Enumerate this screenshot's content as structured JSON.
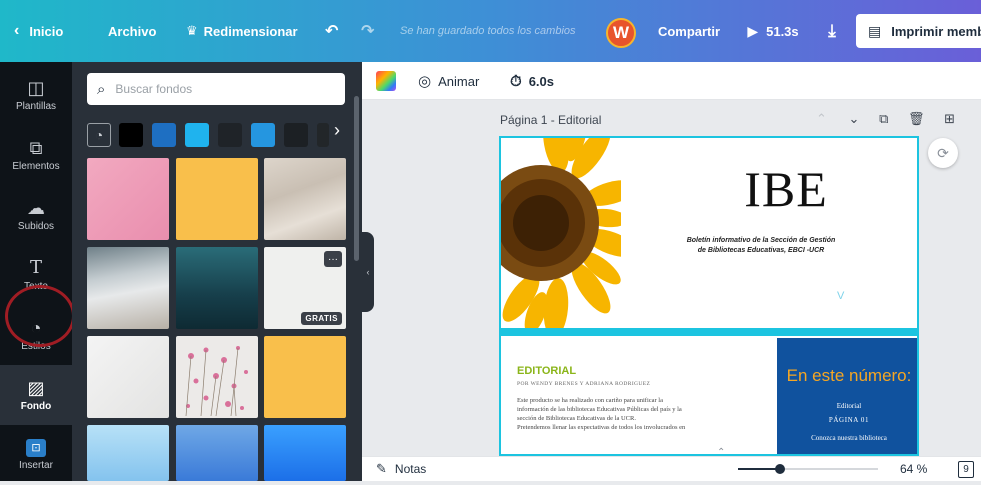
{
  "topbar": {
    "back_label": "Inicio",
    "file_label": "Archivo",
    "resize_label": "Redimensionar",
    "saved_status": "Se han guardado todos los cambios",
    "avatar_initial": "W",
    "share_label": "Compartir",
    "play_duration": "51.3s",
    "print_label": "Imprimir membr"
  },
  "rail": {
    "items": [
      {
        "label": "Plantillas",
        "icon": "template-icon"
      },
      {
        "label": "Elementos",
        "icon": "elements-icon"
      },
      {
        "label": "Subidos",
        "icon": "upload-icon"
      },
      {
        "label": "Texto",
        "icon": "text-icon"
      },
      {
        "label": "Estilos",
        "icon": "palette-icon"
      },
      {
        "label": "Fondo",
        "icon": "background-icon"
      },
      {
        "label": "Insertar",
        "icon": "embed-icon"
      }
    ]
  },
  "panel": {
    "search_placeholder": "Buscar fondos",
    "swatch_colors": [
      "#000000",
      "#1e6fc2",
      "#1fb3ee",
      "#1f2328",
      "#2596e0",
      "#1c2024",
      "#222629"
    ],
    "tiles": [
      {
        "name": "pink-texture",
        "badge": ""
      },
      {
        "name": "yellow-plain",
        "badge": ""
      },
      {
        "name": "sand-texture",
        "badge": ""
      },
      {
        "name": "beach-waves",
        "badge": ""
      },
      {
        "name": "teal-gradient",
        "badge": ""
      },
      {
        "name": "white-paper",
        "badge": "GRATIS"
      },
      {
        "name": "white-wall",
        "badge": ""
      },
      {
        "name": "pink-flowers",
        "badge": ""
      },
      {
        "name": "yellow-plain-2",
        "badge": ""
      },
      {
        "name": "light-blue-gradient",
        "badge": ""
      },
      {
        "name": "blue-gradient",
        "badge": ""
      },
      {
        "name": "blue-bright",
        "badge": ""
      }
    ]
  },
  "editor": {
    "animate_label": "Animar",
    "duration": "6.0s",
    "page_label": "Página 1 - Editorial",
    "notes_label": "Notas",
    "zoom_percent": "64 %",
    "page_count": "9",
    "zoom_level": 0.3
  },
  "document": {
    "title": "IBE",
    "subtitle_line1": "Boletín informativo de la Sección de Gestión",
    "subtitle_line2": "de Bibliotecas Educativas, EBCI -UCR",
    "editorial_heading": "EDITORIAL",
    "byline": "POR WENDY BRENES Y ADRIANA RODRIGUEZ",
    "body_lines": [
      "Este producto se ha realizado con cariño para unificar la",
      "información de las bibliotecas Educativas Públicas del país y la",
      "sección de Bibliotecas Educativas de la UCR.",
      "Pretendemos llenar las expectativas de todos los involucrados en"
    ],
    "sidebar_heading": "En este número:",
    "sidebar_item": "Editorial",
    "sidebar_page": "PÁGINA 01",
    "sidebar_more": "Conozca nuestra biblioteca"
  },
  "colors": {
    "accent_cyan": "#1cc4e0",
    "doc_blue": "#10529e",
    "doc_orange": "#f5a623",
    "editorial_green": "#8bb51a"
  }
}
